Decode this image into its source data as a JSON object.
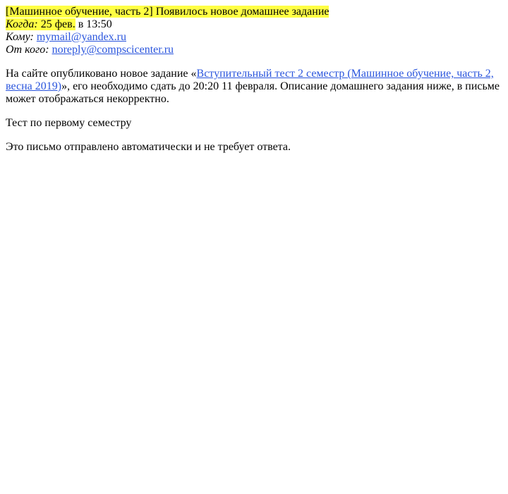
{
  "email": {
    "subject": "[Машинное обучение, часть 2] Появилось новое домашнее задание",
    "when_label": "Когда:",
    "when_date": "25 фев.",
    "when_time_prefix": "в",
    "when_time": "13:50",
    "to_label": "Кому:",
    "to_value": "mymail@yandex.ru",
    "from_label": "От кого:",
    "from_value": "noreply@compscicenter.ru"
  },
  "body": {
    "p1_before": "На сайте опубликовано новое задание «",
    "p1_link": "Вступительный тест 2 семестр (Машинное обучение, часть 2, весна 2019)",
    "p1_after": "», его необходимо сдать до 20:20 11 февраля. Описание домашнего задания ниже, в письме может отображаться некорректно.",
    "p2": "Тест по первому семестру",
    "p3": "Это письмо отправлено автоматически и не требует ответа."
  },
  "colors": {
    "highlight": "#ffff44",
    "link": "#2a55dd"
  }
}
